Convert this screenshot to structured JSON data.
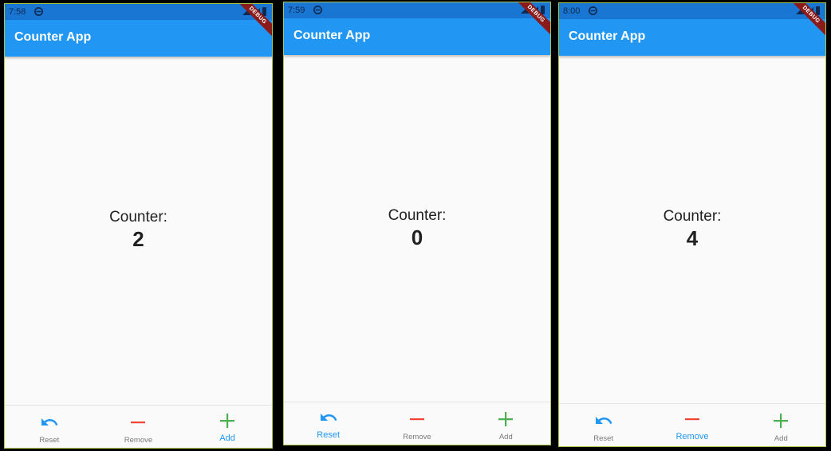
{
  "app": {
    "title": "Counter App",
    "debug_banner": "DEBUG"
  },
  "colors": {
    "primary": "#2196f3",
    "status_bar": "#1976d2",
    "reset_icon": "#2196f3",
    "remove_icon": "#f44336",
    "add_icon": "#4caf50"
  },
  "nav_items": [
    {
      "label": "Reset",
      "icon": "undo-icon"
    },
    {
      "label": "Remove",
      "icon": "minus-icon"
    },
    {
      "label": "Add",
      "icon": "plus-icon"
    }
  ],
  "screens": [
    {
      "time": "7:58",
      "counter_label": "Counter:",
      "counter_value": "2",
      "selected_nav": "Add"
    },
    {
      "time": "7:59",
      "counter_label": "Counter:",
      "counter_value": "0",
      "selected_nav": "Reset"
    },
    {
      "time": "8:00",
      "counter_label": "Counter:",
      "counter_value": "4",
      "selected_nav": "Remove"
    }
  ]
}
